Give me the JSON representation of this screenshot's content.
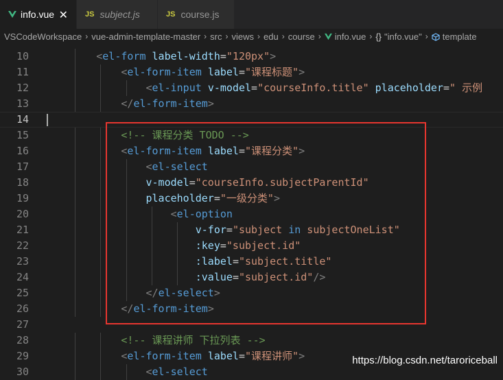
{
  "tabs": [
    {
      "label": "info.vue",
      "icon": "vue-icon",
      "active": true,
      "italic": false
    },
    {
      "label": "subject.js",
      "icon": "js-icon",
      "active": false,
      "italic": true
    },
    {
      "label": "course.js",
      "icon": "js-icon",
      "active": false,
      "italic": false
    }
  ],
  "tab_close_glyph": "✕",
  "js_badge": "JS",
  "breadcrumb": {
    "items": [
      "VSCodeWorkspace",
      "vue-admin-template-master",
      "src",
      "views",
      "edu",
      "course"
    ],
    "file": "info.vue",
    "braces": "{}",
    "symbol": "\"info.vue\"",
    "template": "template",
    "separator": "›"
  },
  "editor": {
    "current_line": 14,
    "lines": [
      {
        "n": "10",
        "tokens": [
          [
            "i",
            "        "
          ],
          [
            "p",
            "<"
          ],
          [
            "t",
            "el-form"
          ],
          [
            "x",
            " "
          ],
          [
            "a",
            "label-width"
          ],
          [
            "e",
            "="
          ],
          [
            "s",
            "\"120px\""
          ],
          [
            "p",
            ">"
          ]
        ]
      },
      {
        "n": "11",
        "tokens": [
          [
            "i",
            "            "
          ],
          [
            "p",
            "<"
          ],
          [
            "t",
            "el-form-item"
          ],
          [
            "x",
            " "
          ],
          [
            "a",
            "label"
          ],
          [
            "e",
            "="
          ],
          [
            "s",
            "\"课程标题\""
          ],
          [
            "p",
            ">"
          ]
        ]
      },
      {
        "n": "12",
        "tokens": [
          [
            "i",
            "                "
          ],
          [
            "p",
            "<"
          ],
          [
            "t",
            "el-input"
          ],
          [
            "x",
            " "
          ],
          [
            "a",
            "v-model"
          ],
          [
            "e",
            "="
          ],
          [
            "s",
            "\"courseInfo.title\""
          ],
          [
            "x",
            " "
          ],
          [
            "a",
            "placeholder"
          ],
          [
            "e",
            "="
          ],
          [
            "s",
            "\" 示例"
          ]
        ]
      },
      {
        "n": "13",
        "tokens": [
          [
            "i",
            "            "
          ],
          [
            "p",
            "</"
          ],
          [
            "t",
            "el-form-item"
          ],
          [
            "p",
            ">"
          ]
        ]
      },
      {
        "n": "14",
        "tokens": []
      },
      {
        "n": "15",
        "tokens": [
          [
            "i",
            "            "
          ],
          [
            "c",
            "<!-- 课程分类 TODO -->"
          ]
        ]
      },
      {
        "n": "16",
        "tokens": [
          [
            "i",
            "            "
          ],
          [
            "p",
            "<"
          ],
          [
            "t",
            "el-form-item"
          ],
          [
            "x",
            " "
          ],
          [
            "a",
            "label"
          ],
          [
            "e",
            "="
          ],
          [
            "s",
            "\"课程分类\""
          ],
          [
            "p",
            ">"
          ]
        ]
      },
      {
        "n": "17",
        "tokens": [
          [
            "i",
            "                "
          ],
          [
            "p",
            "<"
          ],
          [
            "t",
            "el-select"
          ]
        ]
      },
      {
        "n": "18",
        "tokens": [
          [
            "i",
            "                "
          ],
          [
            "a",
            "v-model"
          ],
          [
            "e",
            "="
          ],
          [
            "s",
            "\"courseInfo.subjectParentId\""
          ]
        ]
      },
      {
        "n": "19",
        "tokens": [
          [
            "i",
            "                "
          ],
          [
            "a",
            "placeholder"
          ],
          [
            "e",
            "="
          ],
          [
            "s",
            "\"一级分类\""
          ],
          [
            "p",
            ">"
          ]
        ]
      },
      {
        "n": "20",
        "tokens": [
          [
            "i",
            "                    "
          ],
          [
            "p",
            "<"
          ],
          [
            "t",
            "el-option"
          ]
        ]
      },
      {
        "n": "21",
        "tokens": [
          [
            "i",
            "                        "
          ],
          [
            "a",
            "v-for"
          ],
          [
            "e",
            "="
          ],
          [
            "s",
            "\"subject "
          ],
          [
            "t",
            "in"
          ],
          [
            "s",
            " subjectOneList\""
          ]
        ]
      },
      {
        "n": "22",
        "tokens": [
          [
            "i",
            "                        "
          ],
          [
            "a",
            ":key"
          ],
          [
            "e",
            "="
          ],
          [
            "s",
            "\"subject.id\""
          ]
        ]
      },
      {
        "n": "23",
        "tokens": [
          [
            "i",
            "                        "
          ],
          [
            "a",
            ":label"
          ],
          [
            "e",
            "="
          ],
          [
            "s",
            "\"subject.title\""
          ]
        ]
      },
      {
        "n": "24",
        "tokens": [
          [
            "i",
            "                        "
          ],
          [
            "a",
            ":value"
          ],
          [
            "e",
            "="
          ],
          [
            "s",
            "\"subject.id\""
          ],
          [
            "p",
            "/>"
          ]
        ]
      },
      {
        "n": "25",
        "tokens": [
          [
            "i",
            "                "
          ],
          [
            "p",
            "</"
          ],
          [
            "t",
            "el-select"
          ],
          [
            "p",
            ">"
          ]
        ]
      },
      {
        "n": "26",
        "tokens": [
          [
            "i",
            "            "
          ],
          [
            "p",
            "</"
          ],
          [
            "t",
            "el-form-item"
          ],
          [
            "p",
            ">"
          ]
        ]
      },
      {
        "n": "27",
        "tokens": []
      },
      {
        "n": "28",
        "tokens": [
          [
            "i",
            "            "
          ],
          [
            "c",
            "<!-- 课程讲师 下拉列表 -->"
          ]
        ]
      },
      {
        "n": "29",
        "tokens": [
          [
            "i",
            "            "
          ],
          [
            "p",
            "<"
          ],
          [
            "t",
            "el-form-item"
          ],
          [
            "x",
            " "
          ],
          [
            "a",
            "label"
          ],
          [
            "e",
            "="
          ],
          [
            "s",
            "\"课程讲师\""
          ],
          [
            "p",
            ">"
          ]
        ]
      },
      {
        "n": "30",
        "tokens": [
          [
            "i",
            "                "
          ],
          [
            "p",
            "<"
          ],
          [
            "t",
            "el-select"
          ]
        ]
      }
    ]
  },
  "watermark": "https://blog.csdn.net/taroriceball",
  "colors": {
    "background": "#1e1e1e",
    "tag": "#569cd6",
    "attribute": "#9cdcfe",
    "string": "#ce9178",
    "comment": "#6a9955",
    "highlight_box": "#e8362f"
  }
}
